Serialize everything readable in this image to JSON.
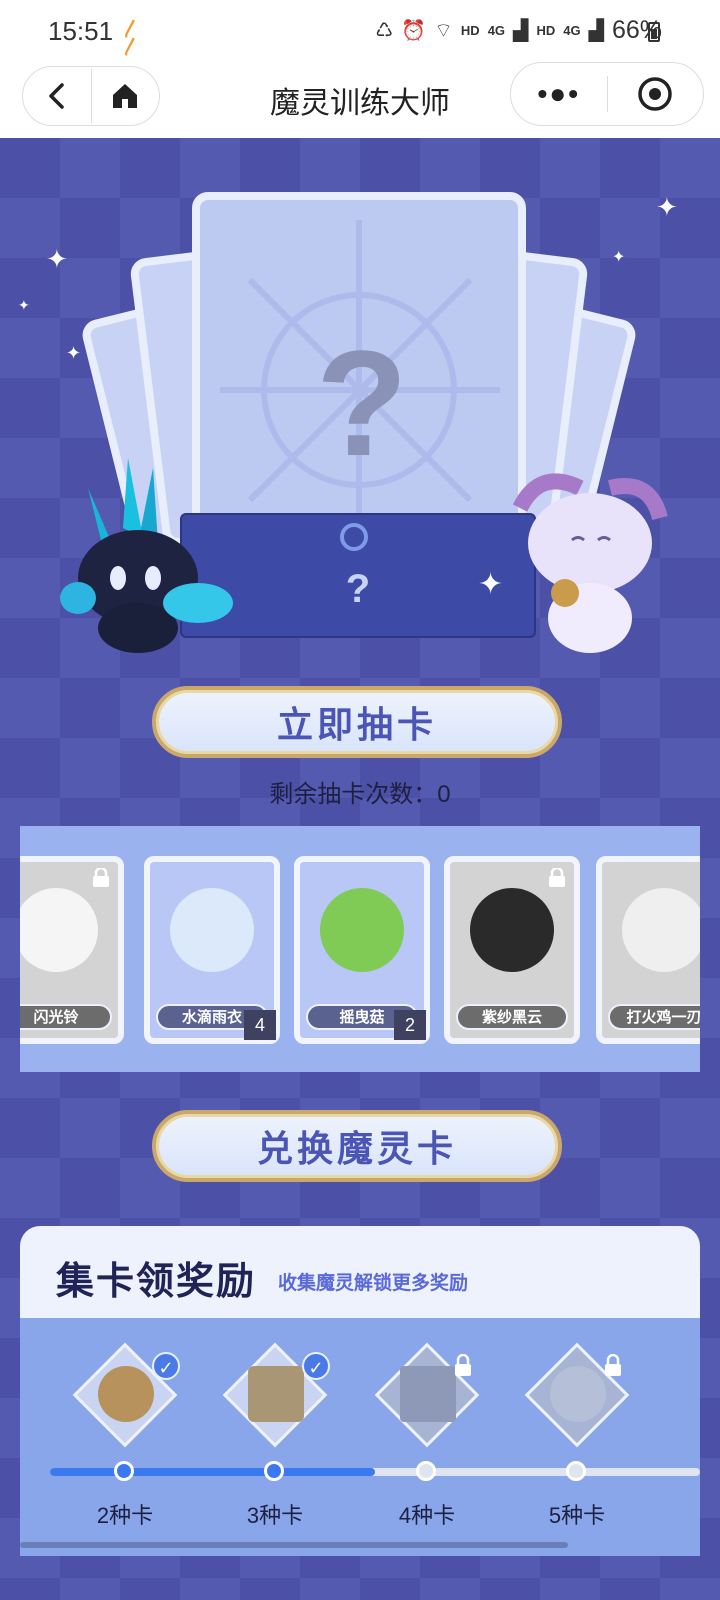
{
  "status": {
    "time": "15:51",
    "network_1": "HD",
    "network_2": "4G",
    "network_3": "HD",
    "network_4": "4G",
    "battery": "66%"
  },
  "nav": {
    "title": "魔灵训练大师",
    "back_icon": "chevron-left-icon",
    "home_icon": "home-icon",
    "more_icon": "more-dots-icon",
    "close_icon": "target-icon"
  },
  "draw": {
    "mystery_mark": "?",
    "envelope_mark": "?",
    "button_label": "立即抽卡",
    "remaining_label": "剩余抽卡次数：0"
  },
  "cards": [
    {
      "name": "闪光铃",
      "locked": true,
      "count": ""
    },
    {
      "name": "水滴雨衣",
      "locked": false,
      "count": "4"
    },
    {
      "name": "摇曳菇",
      "locked": false,
      "count": "2"
    },
    {
      "name": "紫纱黑云",
      "locked": true,
      "count": ""
    },
    {
      "name": "打火鸡一刃",
      "locked": true,
      "count": ""
    }
  ],
  "exchange": {
    "button_label": "兑换魔灵卡"
  },
  "reward": {
    "title": "集卡领奖励",
    "subtitle": "收集魔灵解锁更多奖励",
    "progress": 0.5,
    "tiers": [
      {
        "label": "2种卡",
        "achieved": true
      },
      {
        "label": "3种卡",
        "achieved": true
      },
      {
        "label": "4种卡",
        "achieved": false
      },
      {
        "label": "5种卡",
        "achieved": false
      }
    ]
  },
  "colors": {
    "background": "#4c50a6",
    "accent_blue": "#3b79f0",
    "button_text": "#4a55b6"
  }
}
